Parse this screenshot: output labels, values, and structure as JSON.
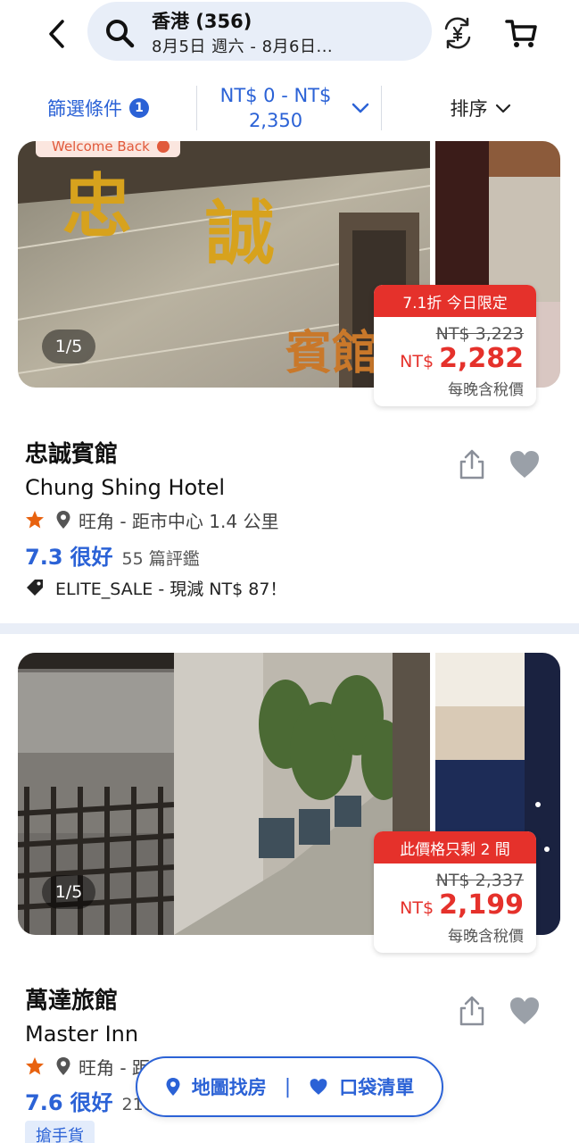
{
  "header": {
    "search_title": "香港 (356)",
    "search_dates": "8月5日 週六 - 8月6日..."
  },
  "filters": {
    "filter_label": "篩選條件",
    "filter_count": "1",
    "price_line1": "NT$ 0 - NT$",
    "price_line2": "2,350",
    "sort_label": "排序"
  },
  "hotels": [
    {
      "welcome_tag": "Welcome Back",
      "photo_counter": "1/5",
      "deal_ribbon": "7.1折 今日限定",
      "old_price": "NT$ 3,223",
      "currency": "NT$",
      "price": "2,282",
      "price_note": "每晚含稅價",
      "name_zh": "忠誠賓館",
      "name_en": "Chung Shing Hotel",
      "location": "旺角 - 距市中心 1.4 公里",
      "rating_score": "7.3",
      "rating_word": "很好",
      "review_count": "55 篇評鑑",
      "promo": "ELITE_SALE - 現減 NT$ 87！"
    },
    {
      "photo_counter": "1/5",
      "deal_ribbon": "此價格只剩 2 間",
      "old_price": "NT$ 2,337",
      "currency": "NT$",
      "price": "2,199",
      "price_note": "每晚含稅價",
      "name_zh": "萬達旅館",
      "name_en": "Master Inn",
      "location": "旺角 - 距",
      "rating_score": "7.6",
      "rating_word": "很好",
      "review_count": "21",
      "tag": "搶手貨"
    }
  ],
  "floating_bar": {
    "map_label": "地圖找房",
    "wishlist_label": "口袋清單"
  },
  "colors": {
    "accent": "#2b62d6",
    "deal_red": "#e5312b",
    "search_bg": "#e8eef8"
  }
}
